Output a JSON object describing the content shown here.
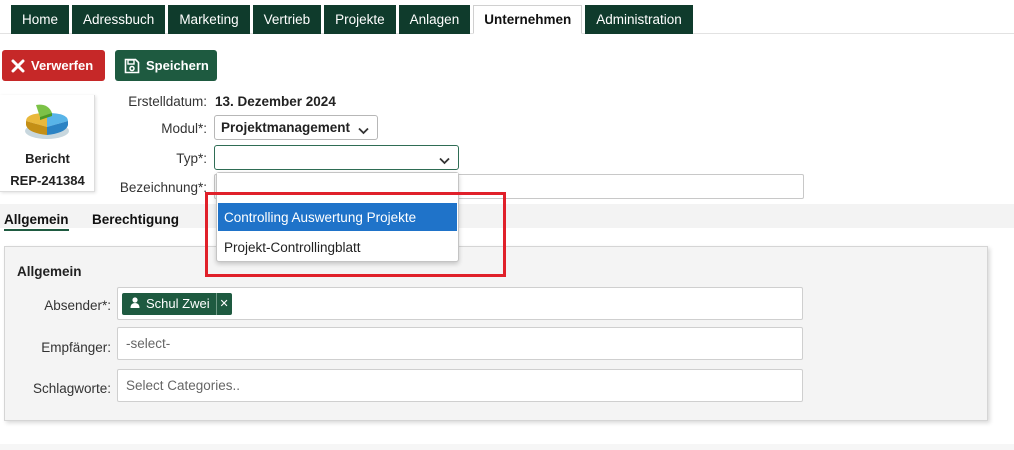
{
  "nav": {
    "tabs": [
      {
        "label": "Home"
      },
      {
        "label": "Adressbuch"
      },
      {
        "label": "Marketing"
      },
      {
        "label": "Vertrieb"
      },
      {
        "label": "Projekte"
      },
      {
        "label": "Anlagen"
      },
      {
        "label": "Unternehmen"
      },
      {
        "label": "Administration"
      }
    ],
    "active": "Unternehmen"
  },
  "toolbar": {
    "discard_label": "Verwerfen",
    "save_label": "Speichern",
    "discard_color": "#c62828",
    "save_color": "#1e5a40"
  },
  "record": {
    "kind": "Bericht",
    "number": "REP-241384",
    "icon": "report-chart-icon"
  },
  "form": {
    "created_label": "Erstelldatum:",
    "created_value": "13. Dezember 2024",
    "module_label": "Modul*:",
    "module_value": "Projektmanagement",
    "type_label": "Typ*:",
    "type_value": "",
    "name_label": "Bezeichnung*:",
    "name_value": ""
  },
  "type_dropdown": {
    "search_value": "",
    "options": [
      {
        "label": "Controlling Auswertung Projekte",
        "highlighted": true
      },
      {
        "label": "Projekt-Controllingblatt",
        "highlighted": false
      }
    ]
  },
  "subtabs": [
    {
      "label": "Allgemein",
      "active": true
    },
    {
      "label": "Berechtigung",
      "active": false
    }
  ],
  "panel": {
    "title": "Allgemein",
    "sender_label": "Absender*:",
    "sender_tag": "Schul Zwei",
    "recipient_label": "Empfänger:",
    "recipient_placeholder": "-select-",
    "keywords_label": "Schlagworte:",
    "keywords_placeholder": "Select Categories.."
  },
  "colors": {
    "nav_bg": "#0f3b2c",
    "accent": "#1e5a40",
    "highlight_option": "#1f73c9",
    "annotation_box": "#e0202a"
  }
}
